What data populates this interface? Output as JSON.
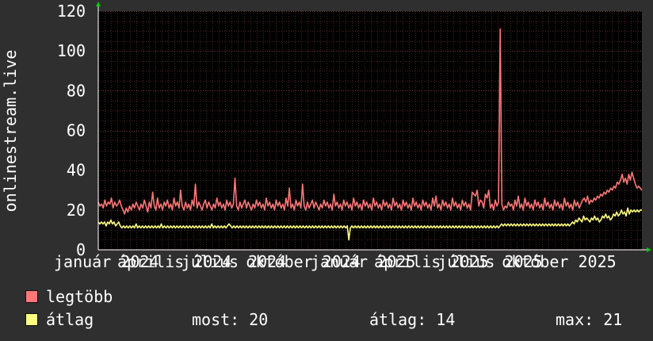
{
  "chart_data": {
    "type": "line",
    "ylabel": "onlinestream.live",
    "xlabel": "",
    "ylim": [
      0,
      120
    ],
    "y_ticks": [
      0,
      20,
      40,
      60,
      80,
      100,
      120
    ],
    "x_tick_labels": [
      "január 2024",
      "április 2024",
      "július 2024",
      "október 2024",
      "január 2025",
      "április 2025",
      "július 2025",
      "október 2025"
    ],
    "x_tick_positions": [
      0,
      0.1166,
      0.2344,
      0.3534,
      0.4722,
      0.589,
      0.7058,
      0.8239
    ],
    "grid": true,
    "background": "#000000",
    "series": [
      {
        "name": "legtöbb",
        "color": "#ff7777",
        "values": [
          24,
          22,
          23,
          21,
          25,
          22,
          24,
          23,
          26,
          21,
          24,
          22,
          23,
          25,
          22,
          20,
          18,
          21,
          19,
          22,
          20,
          23,
          21,
          24,
          22,
          20,
          23,
          21,
          25,
          22,
          19,
          24,
          21,
          29,
          22,
          20,
          26,
          21,
          23,
          20,
          24,
          22,
          25,
          21,
          23,
          20,
          26,
          22,
          24,
          21,
          30,
          22,
          20,
          24,
          21,
          23,
          20,
          25,
          22,
          33,
          21,
          24,
          22,
          20,
          23,
          25,
          21,
          24,
          22,
          20,
          23,
          21,
          26,
          22,
          24,
          21,
          23,
          20,
          25,
          22,
          24,
          21,
          23,
          36,
          22,
          20,
          24,
          21,
          23,
          25,
          21,
          24,
          22,
          20,
          23,
          21,
          25,
          22,
          24,
          21,
          23,
          20,
          26,
          22,
          24,
          21,
          23,
          20,
          25,
          22,
          24,
          21,
          23,
          20,
          26,
          22,
          31,
          21,
          23,
          20,
          25,
          22,
          24,
          21,
          33,
          22,
          20,
          24,
          21,
          23,
          25,
          21,
          24,
          22,
          20,
          23,
          21,
          25,
          22,
          24,
          21,
          23,
          20,
          28,
          22,
          24,
          21,
          23,
          20,
          25,
          22,
          24,
          21,
          23,
          20,
          26,
          22,
          24,
          21,
          23,
          20,
          25,
          22,
          24,
          21,
          23,
          20,
          26,
          22,
          24,
          21,
          23,
          20,
          25,
          22,
          24,
          21,
          23,
          20,
          26,
          22,
          24,
          21,
          23,
          20,
          25,
          22,
          24,
          21,
          23,
          20,
          26,
          22,
          24,
          21,
          23,
          20,
          25,
          22,
          24,
          21,
          23,
          20,
          26,
          22,
          27,
          21,
          23,
          20,
          25,
          22,
          24,
          21,
          23,
          20,
          26,
          22,
          24,
          21,
          23,
          20,
          25,
          22,
          24,
          21,
          23,
          20,
          29,
          28,
          27,
          30,
          22,
          25,
          24,
          21,
          28,
          26,
          30,
          21,
          23,
          20,
          25,
          22,
          24,
          111,
          23,
          20,
          22,
          21,
          24,
          22,
          23,
          20,
          25,
          22,
          27,
          21,
          23,
          20,
          26,
          22,
          24,
          21,
          23,
          20,
          25,
          22,
          24,
          21,
          23,
          20,
          26,
          22,
          24,
          21,
          23,
          20,
          25,
          22,
          24,
          21,
          23,
          20,
          26,
          22,
          24,
          21,
          23,
          20,
          25,
          22,
          24,
          21,
          23,
          25,
          26,
          24,
          27,
          23,
          25,
          24,
          26,
          25,
          27,
          26,
          28,
          27,
          29,
          28,
          30,
          29,
          31,
          30,
          32,
          31,
          34,
          33,
          35,
          38,
          34,
          36,
          33,
          38,
          35,
          39,
          36,
          33,
          31,
          32,
          31,
          30
        ]
      },
      {
        "name": "átlag",
        "color": "#ffff80",
        "values": [
          14,
          13,
          14,
          13,
          14,
          12,
          14,
          13,
          15,
          13,
          14,
          12,
          13,
          14,
          12,
          11,
          12,
          11,
          12,
          11,
          12,
          11,
          12,
          11,
          13,
          11,
          12,
          11,
          12,
          11,
          12,
          11,
          12,
          11,
          12,
          11,
          12,
          11,
          12,
          11,
          13,
          11,
          12,
          11,
          12,
          11,
          12,
          11,
          12,
          11,
          12,
          11,
          12,
          11,
          12,
          11,
          12,
          11,
          12,
          11,
          12,
          11,
          12,
          11,
          12,
          11,
          12,
          11,
          12,
          11,
          12,
          11,
          13,
          11,
          12,
          11,
          12,
          11,
          12,
          11,
          12,
          11,
          12,
          13,
          12,
          11,
          12,
          11,
          12,
          11,
          12,
          11,
          12,
          11,
          12,
          11,
          12,
          11,
          12,
          11,
          12,
          11,
          12,
          11,
          12,
          11,
          12,
          11,
          12,
          11,
          12,
          11,
          12,
          11,
          12,
          11,
          12,
          11,
          12,
          11,
          12,
          11,
          12,
          11,
          12,
          11,
          12,
          11,
          12,
          11,
          12,
          11,
          12,
          11,
          12,
          11,
          12,
          11,
          12,
          11,
          12,
          11,
          12,
          11,
          12,
          11,
          12,
          11,
          12,
          11,
          12,
          11,
          12,
          11,
          12,
          11,
          12,
          11,
          12,
          5,
          11,
          12,
          11,
          12,
          11,
          12,
          11,
          12,
          11,
          12,
          11,
          12,
          11,
          12,
          11,
          12,
          11,
          12,
          11,
          12,
          11,
          12,
          11,
          12,
          11,
          12,
          11,
          12,
          11,
          12,
          11,
          12,
          11,
          12,
          11,
          12,
          11,
          12,
          11,
          12,
          11,
          12,
          11,
          12,
          11,
          12,
          11,
          12,
          11,
          12,
          11,
          12,
          11,
          12,
          11,
          12,
          11,
          12,
          11,
          12,
          11,
          12,
          11,
          12,
          11,
          12,
          11,
          12,
          11,
          12,
          11,
          12,
          11,
          12,
          11,
          12,
          11,
          12,
          11,
          12,
          11,
          12,
          11,
          12,
          11,
          12,
          11,
          12,
          11,
          12,
          11,
          12,
          11,
          12,
          11,
          12,
          13,
          12,
          13,
          12,
          13,
          12,
          13,
          12,
          13,
          12,
          13,
          12,
          13,
          12,
          13,
          12,
          13,
          12,
          13,
          12,
          13,
          12,
          13,
          12,
          13,
          12,
          13,
          12,
          13,
          12,
          13,
          12,
          13,
          12,
          13,
          12,
          13,
          12,
          13,
          12,
          13,
          12,
          13,
          12,
          13,
          14,
          13,
          15,
          14,
          16,
          15,
          14,
          17,
          15,
          16,
          15,
          14,
          16,
          15,
          17,
          15,
          16,
          14,
          15,
          17,
          16,
          18,
          16,
          17,
          15,
          16,
          18,
          17,
          19,
          17,
          18,
          20,
          18,
          19,
          17,
          21,
          18,
          20,
          19,
          20,
          19,
          20,
          19,
          20,
          20
        ]
      }
    ]
  },
  "legend": {
    "max_label": "legtöbb",
    "avg_label": "átlag",
    "max_color": "#ff7777",
    "avg_color": "#ffff80"
  },
  "stats": {
    "current": "most: 20",
    "average": "átlag: 14",
    "maximum": "max: 21"
  }
}
